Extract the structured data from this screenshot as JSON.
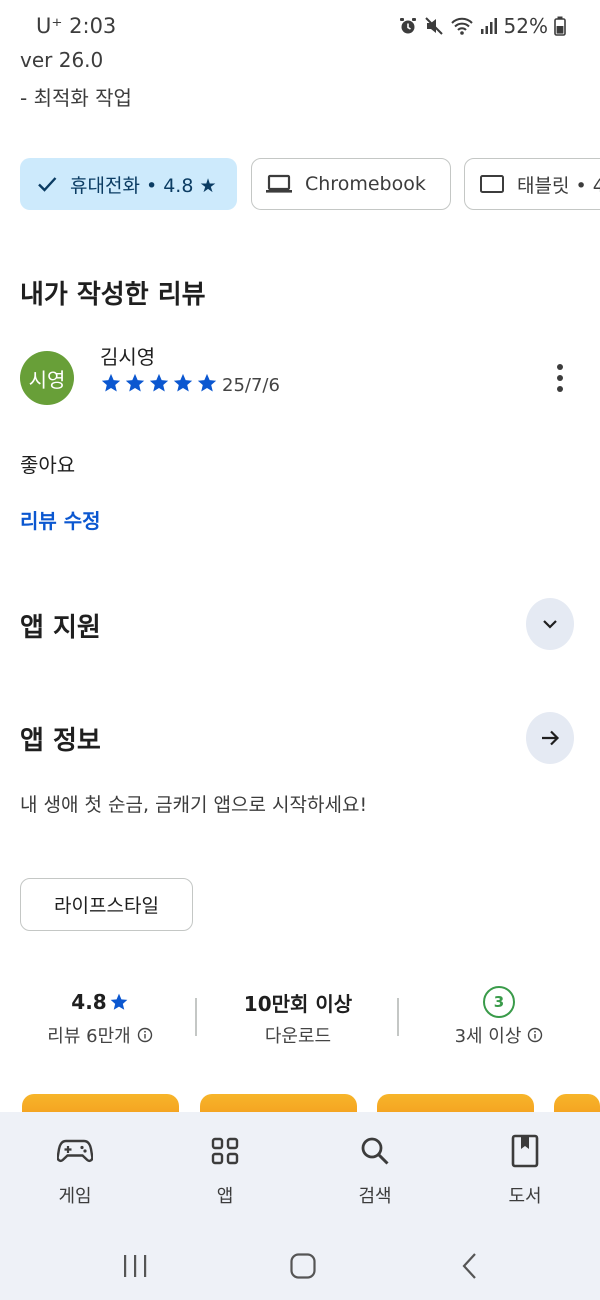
{
  "status_bar": {
    "carrier_time": "U⁺ 2:03",
    "battery": "52%",
    "icons": [
      "alarm-icon",
      "mute-icon",
      "wifi-icon",
      "signal-icon",
      "battery-icon"
    ]
  },
  "whats_new": {
    "version": "ver 26.0",
    "note": "- 최적화 작업"
  },
  "device_chips": [
    {
      "label": "휴대전화 • 4.8 ★",
      "icon": "check-icon",
      "selected": true
    },
    {
      "label": "Chromebook",
      "icon": "laptop-icon",
      "selected": false
    },
    {
      "label": "태블릿 • 4",
      "icon": "tablet-icon",
      "selected": false
    }
  ],
  "my_review": {
    "heading": "내가 작성한 리뷰",
    "avatar_text": "시영",
    "reviewer": "김시영",
    "stars": 5,
    "date": "25/7/6",
    "text": "좋아요",
    "edit_link": "리뷰 수정"
  },
  "app_support": {
    "heading": "앱 지원"
  },
  "app_info": {
    "heading": "앱 정보",
    "description": "내 생애 첫 순금, 금캐기 앱으로 시작하세요!",
    "category_tag": "라이프스타일"
  },
  "stats": {
    "rating_value": "4.8",
    "rating_label": "리뷰 6만개",
    "downloads_value": "10만회 이상",
    "downloads_label": "다운로드",
    "age_badge": "3",
    "age_label": "3세 이상"
  },
  "bottom_nav": [
    {
      "label": "게임",
      "icon": "gamepad-icon"
    },
    {
      "label": "앱",
      "icon": "apps-grid-icon"
    },
    {
      "label": "검색",
      "icon": "search-icon"
    },
    {
      "label": "도서",
      "icon": "book-icon"
    }
  ],
  "colors": {
    "accent": "#0b57d0",
    "chip_selected_bg": "#cdeafc",
    "avatar_bg": "#689f38",
    "age_green": "#3a9b4a",
    "nav_bg": "#eef1f7"
  }
}
